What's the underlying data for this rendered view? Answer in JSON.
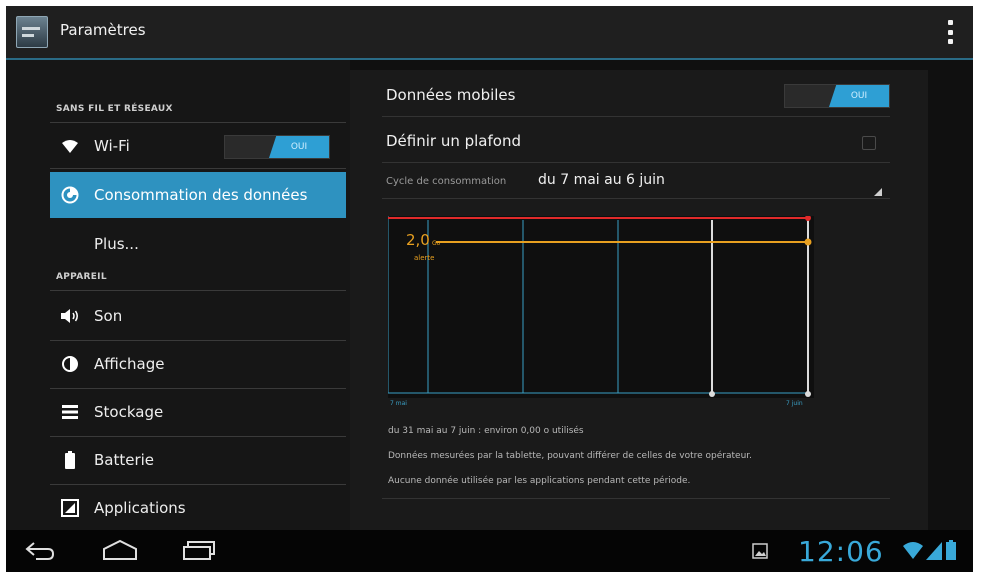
{
  "actionbar": {
    "title": "Paramètres",
    "app_icon": "settings-app-icon",
    "overflow_icon": "overflow-menu-icon"
  },
  "sidebar": {
    "sections": [
      {
        "title": "SANS FIL ET RÉSEAUX"
      },
      {
        "title": "APPAREIL"
      }
    ],
    "items": [
      {
        "label": "Wi-Fi",
        "icon": "wifi-icon"
      },
      {
        "label": "Consommation des données",
        "icon": "data-usage-icon",
        "selected": true
      },
      {
        "label": "Plus...",
        "icon": ""
      },
      {
        "label": "Son",
        "icon": "speaker-icon"
      },
      {
        "label": "Affichage",
        "icon": "display-icon"
      },
      {
        "label": "Stockage",
        "icon": "storage-icon"
      },
      {
        "label": "Batterie",
        "icon": "battery-icon"
      },
      {
        "label": "Applications",
        "icon": "applications-icon"
      }
    ],
    "wifi_toggle": "OUI"
  },
  "detail": {
    "mobile_data_label": "Données mobiles",
    "mobile_data_toggle": "OUI",
    "set_limit_label": "Définir un plafond",
    "cycle_label": "Cycle de consommation",
    "cycle_value": "du 7 mai au 6 juin",
    "chart": {
      "warning_value": "2,0",
      "warning_unit": "Go",
      "warning_label": "alerte",
      "start_label": "7 mai",
      "end_label": "7 juin"
    },
    "usage_summary": "du 31 mai au 7 juin : environ 0,00 o utilisés",
    "measured_note": "Données mesurées par la tablette, pouvant différer de celles de votre opérateur.",
    "no_app_data": "Aucune donnée utilisée par les applications pendant cette période."
  },
  "navbar": {
    "back_icon": "back-icon",
    "home_icon": "home-icon",
    "recents_icon": "recent-apps-icon",
    "gallery_icon": "gallery-notification-icon",
    "time": "12:06"
  },
  "colors": {
    "accent": "#2e92c0",
    "limit_line": "#e02a2a",
    "warning_line": "#e8a020",
    "chart_grid": "#3a9fc4"
  }
}
